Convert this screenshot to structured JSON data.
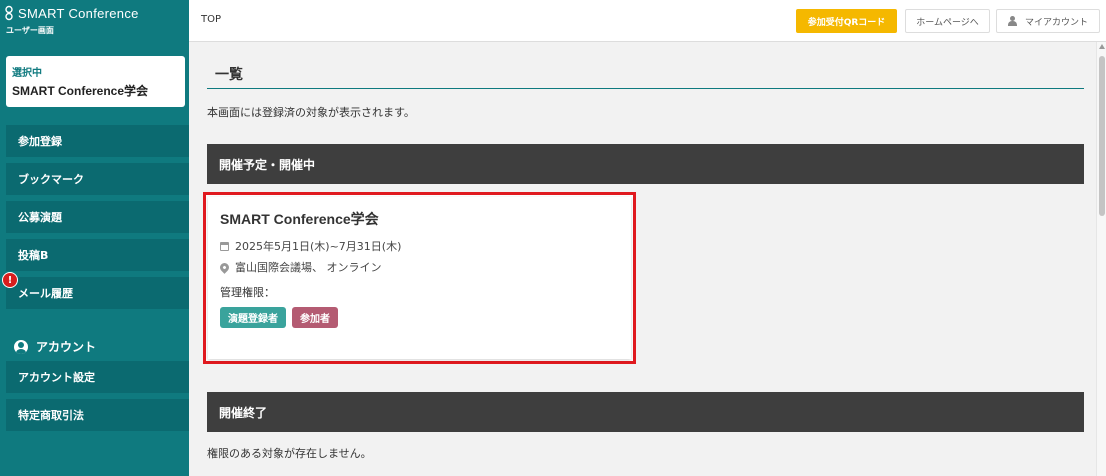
{
  "brand": {
    "title": "SMART Conference",
    "subtitle": "ユーザー画面"
  },
  "selected": {
    "label": "選択中",
    "name": "SMART Conference学会"
  },
  "nav": {
    "items": [
      {
        "label": "参加登録"
      },
      {
        "label": "ブックマーク"
      },
      {
        "label": "公募演題"
      },
      {
        "label": "投稿B"
      },
      {
        "label": "メール履歴",
        "badge": "!"
      }
    ]
  },
  "account_section": {
    "heading": "アカウント",
    "items": [
      {
        "label": "アカウント設定"
      },
      {
        "label": "特定商取引法"
      }
    ]
  },
  "topbar": {
    "breadcrumb": "TOP",
    "qr_button": "参加受付QRコード",
    "home_button": "ホームページへ",
    "account_button": "マイアカウント"
  },
  "main": {
    "title": "一覧",
    "description": "本画面には登録済の対象が表示されます。",
    "upcoming_heading": "開催予定・開催中",
    "ended_heading": "開催終了",
    "ended_message": "権限のある対象が存在しません。",
    "conference": {
      "name": "SMART Conference学会",
      "dates": "2025年5月1日(木)~7月31日(木)",
      "venue": "富山国際会議場、 オンライン",
      "permission_label": "管理権限：",
      "tags": [
        "演題登録者",
        "参加者"
      ]
    }
  },
  "colors": {
    "sidebar": "#0f7a7f",
    "nav_item": "#0b6a70",
    "qr_button": "#f5b800",
    "section_bar": "#3e3e3e",
    "highlight_border": "#e0191f",
    "tag_teal": "#3aa39c",
    "tag_rose": "#b45b72",
    "badge": "#d81e1e"
  }
}
